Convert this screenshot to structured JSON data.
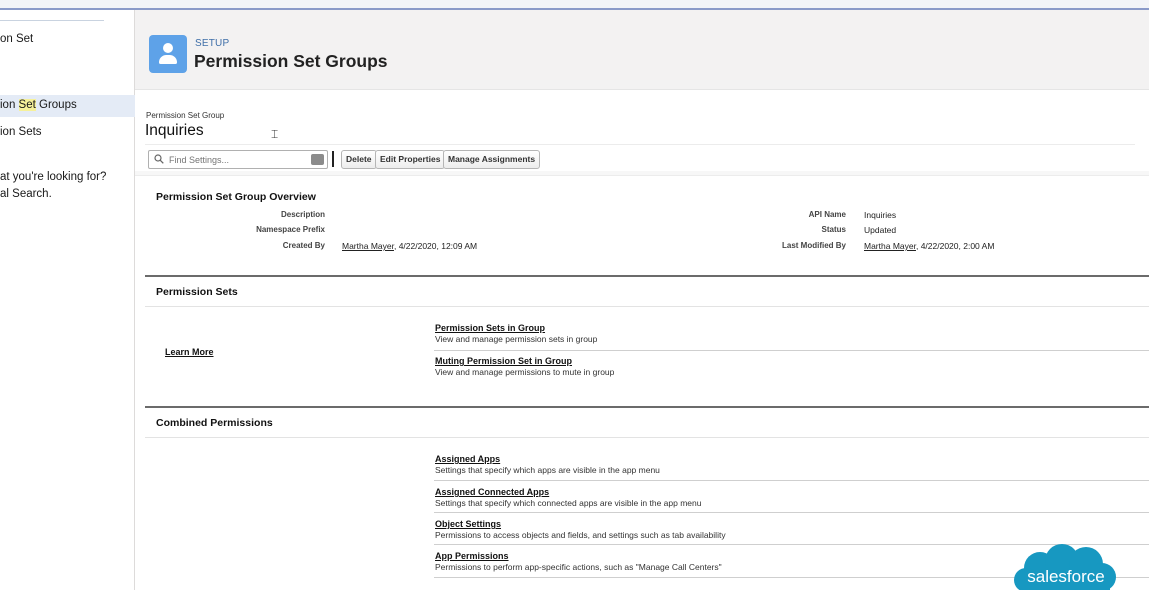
{
  "sidebar": {
    "item_top": "on Set",
    "item_groups_prefix": "ion ",
    "item_groups_highlight": "Set",
    "item_groups_suffix": " Groups",
    "item_sets_prefix": "ion ",
    "item_sets_highlight": "Sets",
    "help_line1": "at you're looking for?",
    "help_line2": "al Search."
  },
  "header": {
    "eyebrow": "SETUP",
    "title": "Permission Set Groups",
    "icon": "user-icon"
  },
  "record": {
    "eyebrow": "Permission Set Group",
    "title": "Inquiries"
  },
  "toolbar": {
    "find_placeholder": "Find Settings...",
    "delete_label": "Delete",
    "edit_label": "Edit Properties",
    "manage_label": "Manage Assignments"
  },
  "overview": {
    "heading": "Permission Set Group Overview",
    "description_label": "Description",
    "description_value": "",
    "namespace_label": "Namespace Prefix",
    "namespace_value": "",
    "created_label": "Created By",
    "created_user": "Martha Mayer",
    "created_date": ", 4/22/2020, 12:09 AM",
    "api_label": "API Name",
    "api_value": "Inquiries",
    "status_label": "Status",
    "status_value": "Updated",
    "modified_label": "Last Modified By",
    "modified_user": "Martha Mayer",
    "modified_date": ", 4/22/2020, 2:00 AM"
  },
  "permission_sets": {
    "heading": "Permission Sets",
    "learn_more": "Learn More",
    "items": [
      {
        "title": "Permission Sets in Group",
        "desc": "View and manage permission sets in group"
      },
      {
        "title": "Muting Permission Set in Group",
        "desc": "View and manage permissions to mute in group"
      }
    ]
  },
  "combined": {
    "heading": "Combined Permissions",
    "items": [
      {
        "title": "Assigned Apps",
        "desc": "Settings that specify which apps are visible in the app menu"
      },
      {
        "title": "Assigned Connected Apps",
        "desc": "Settings that specify which connected apps are visible in the app menu"
      },
      {
        "title": "Object Settings",
        "desc": "Permissions to access objects and fields, and settings such as tab availability"
      },
      {
        "title": "App Permissions",
        "desc": "Permissions to perform app-specific actions, such as \"Manage Call Centers\""
      }
    ]
  },
  "watermark": {
    "text": "salesforce",
    "color": "#1798c1"
  }
}
